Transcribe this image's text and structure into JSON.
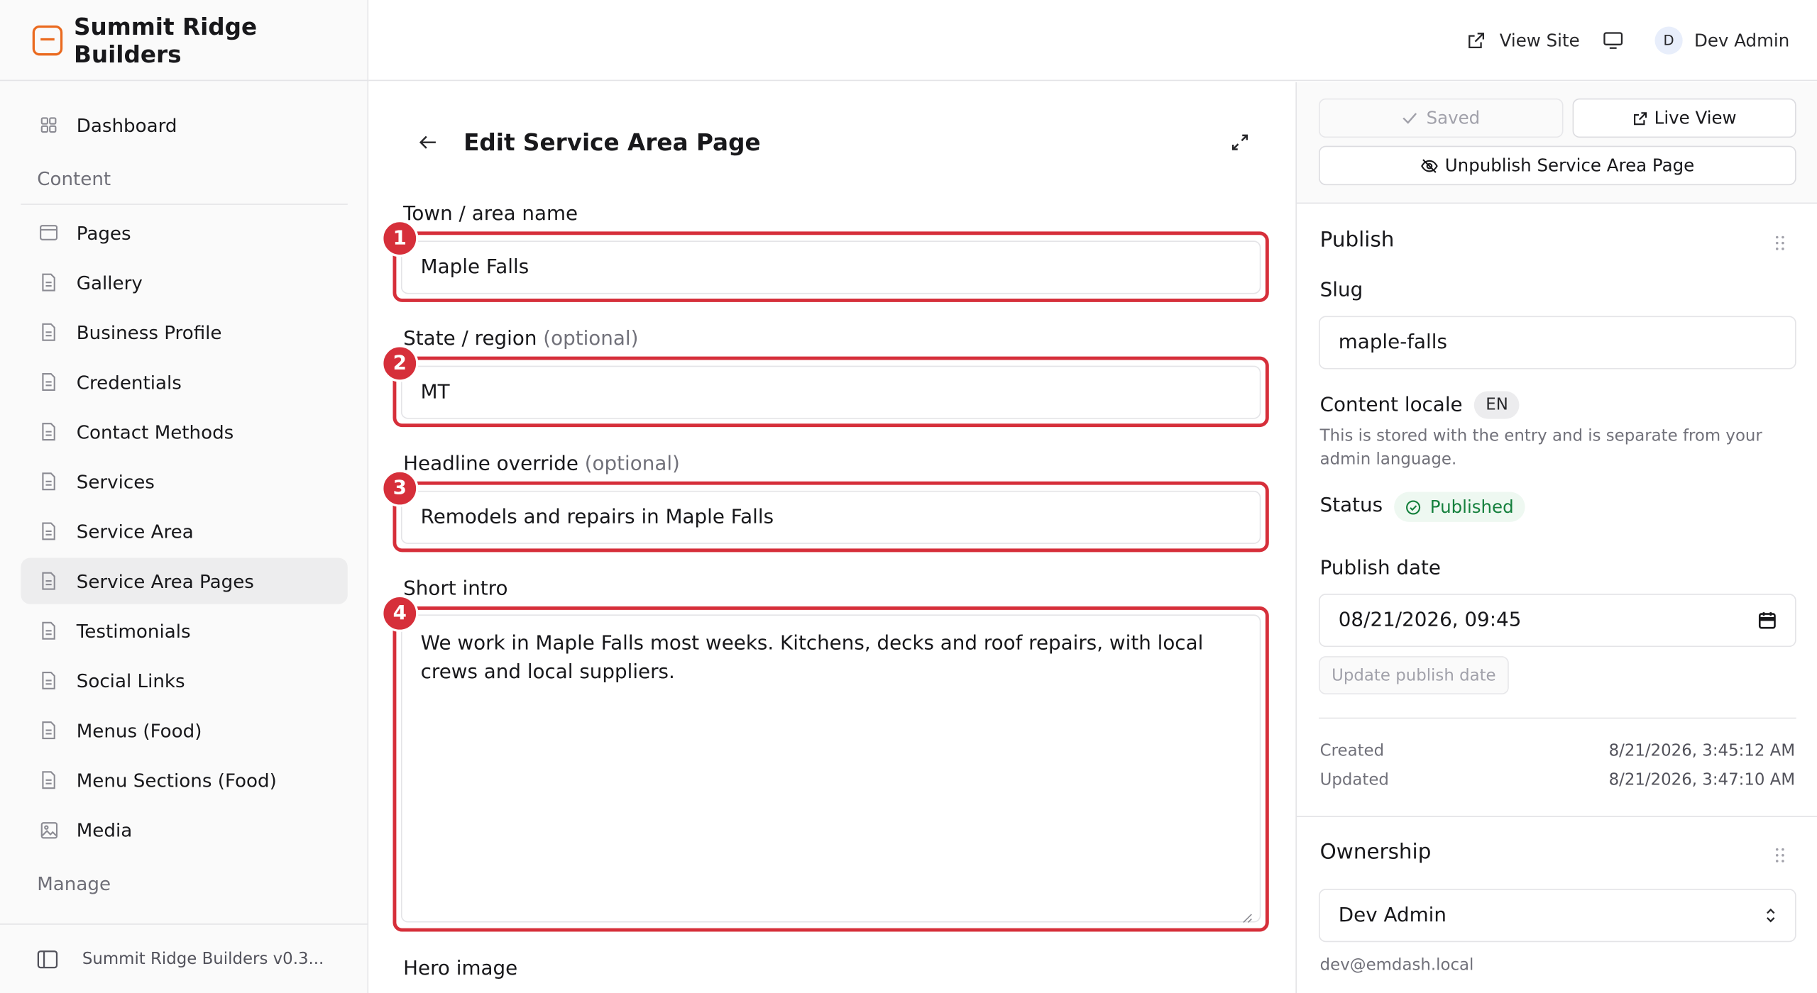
{
  "brand": {
    "name": "Summit Ridge Builders",
    "accent": "#ea6a1f"
  },
  "header": {
    "view_site": "View Site",
    "user": {
      "initial": "D",
      "name": "Dev Admin"
    }
  },
  "sidebar": {
    "dashboard": "Dashboard",
    "content_section": "Content",
    "items": [
      {
        "label": "Pages",
        "icon": "window-icon"
      },
      {
        "label": "Gallery",
        "icon": "document-icon"
      },
      {
        "label": "Business Profile",
        "icon": "document-icon"
      },
      {
        "label": "Credentials",
        "icon": "document-icon"
      },
      {
        "label": "Contact Methods",
        "icon": "document-icon"
      },
      {
        "label": "Services",
        "icon": "document-icon"
      },
      {
        "label": "Service Area",
        "icon": "document-icon"
      },
      {
        "label": "Service Area Pages",
        "icon": "document-icon",
        "active": true
      },
      {
        "label": "Testimonials",
        "icon": "document-icon"
      },
      {
        "label": "Social Links",
        "icon": "document-icon"
      },
      {
        "label": "Menus (Food)",
        "icon": "document-icon"
      },
      {
        "label": "Menu Sections (Food)",
        "icon": "document-icon"
      },
      {
        "label": "Media",
        "icon": "image-icon"
      }
    ],
    "manage_section": "Manage",
    "footer": "Summit Ridge Builders v0.3..."
  },
  "editor": {
    "title": "Edit Service Area Page",
    "fields": {
      "town": {
        "label": "Town / area name",
        "value": "Maple Falls",
        "badge": "1"
      },
      "state": {
        "label": "State / region",
        "optional": "(optional)",
        "value": "MT",
        "badge": "2"
      },
      "headline": {
        "label": "Headline override",
        "optional": "(optional)",
        "value": "Remodels and repairs in Maple Falls",
        "badge": "3"
      },
      "intro": {
        "label": "Short intro",
        "value": "We work in Maple Falls most weeks. Kitchens, decks and roof repairs, with local crews and local suppliers.",
        "badge": "4"
      }
    },
    "hero_label": "Hero image",
    "highlight_color": "#d62f3a"
  },
  "panel": {
    "saved": "Saved",
    "live_view": "Live View",
    "unpublish": "Unpublish Service Area Page",
    "publish": {
      "title": "Publish",
      "slug_label": "Slug",
      "slug": "maple-falls",
      "locale_label": "Content locale",
      "locale": "EN",
      "locale_help": "This is stored with the entry and is separate from your admin language.",
      "status_label": "Status",
      "status": "Published",
      "status_color": "#15803d",
      "date_label": "Publish date",
      "date": "08/21/2026, 09:45",
      "update_date": "Update publish date",
      "created_label": "Created",
      "created": "8/21/2026, 3:45:12 AM",
      "updated_label": "Updated",
      "updated": "8/21/2026, 3:47:10 AM"
    },
    "ownership": {
      "title": "Ownership",
      "owner": "Dev Admin",
      "email": "dev@emdash.local"
    }
  }
}
